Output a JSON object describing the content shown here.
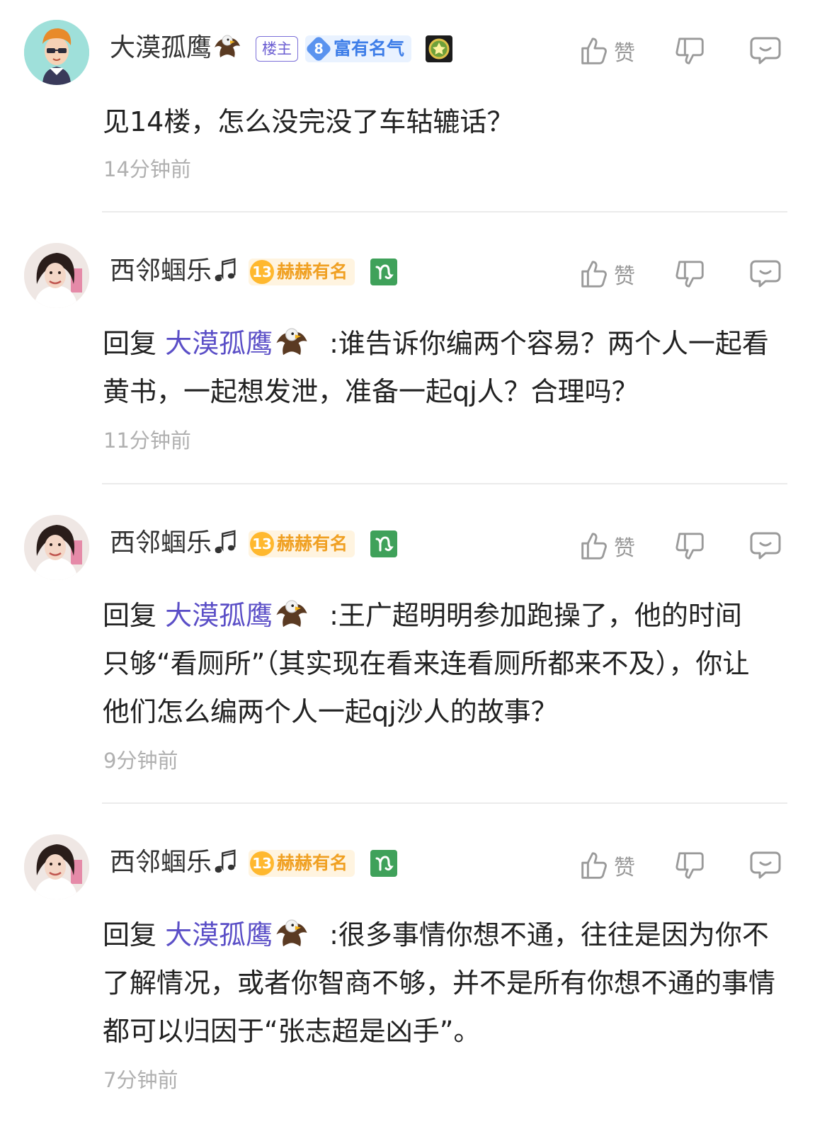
{
  "comments": [
    {
      "username": "大漠孤鹰",
      "host_badge": "楼主",
      "level": "8",
      "level_title": "富有名气",
      "like_label": "赞",
      "text": "见14楼，怎么没完没了车轱辘话？",
      "time": "14分钟前"
    },
    {
      "username": "西邻蝈乐",
      "level": "13",
      "level_title": "赫赫有名",
      "like_label": "赞",
      "reply_prefix": "回复",
      "reply_to": "大漠孤鹰",
      "text": ":谁告诉你编两个容易？两个人一起看黄书，一起想发泄，准备一起qj人？合理吗？",
      "time": "11分钟前"
    },
    {
      "username": "西邻蝈乐",
      "level": "13",
      "level_title": "赫赫有名",
      "like_label": "赞",
      "reply_prefix": "回复",
      "reply_to": "大漠孤鹰",
      "text": ":王广超明明参加跑操了，他的时间只够“看厕所”（其实现在看来连看厕所都来不及），你让他们怎么编两个人一起qj沙人的故事？",
      "time": "9分钟前"
    },
    {
      "username": "西邻蝈乐",
      "level": "13",
      "level_title": "赫赫有名",
      "like_label": "赞",
      "reply_prefix": "回复",
      "reply_to": "大漠孤鹰",
      "text": ":很多事情你想不通，往往是因为你不了解情况，或者你智商不够，并不是所有你想不通的事情都可以归因于“张志超是凶手”。",
      "time": "7分钟前"
    }
  ],
  "icons": {
    "eagle": "eagle-icon",
    "music": "music-note-icon",
    "like": "thumbs-up-icon",
    "dislike": "thumbs-down-icon",
    "reply": "comment-bubble-icon",
    "medal": "medal-icon",
    "zodiac": "capricorn-icon"
  },
  "colors": {
    "reply_name": "#5b4fc7",
    "time": "#b0b0b0",
    "level_blue": "#3d7de8",
    "level_gold": "#f0a022"
  }
}
